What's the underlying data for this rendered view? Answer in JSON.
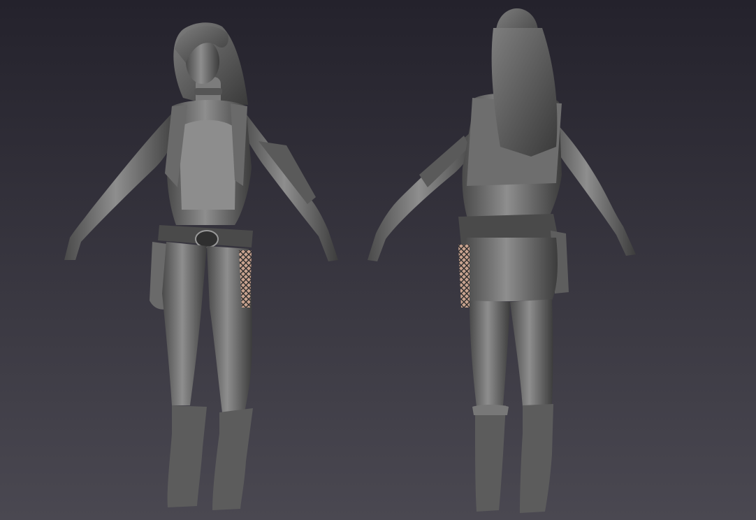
{
  "scene": {
    "description_key": "character-turnaround",
    "views": [
      "front",
      "back"
    ],
    "colors": {
      "bg_top": "#24222c",
      "bg_bottom": "#48464f",
      "clay_light": "#8a8a8a",
      "clay_mid": "#6a6a6a",
      "clay_dark": "#3e3e3e",
      "clay_shadow": "#2c2c2c",
      "skin_mesh": "#c9a38f"
    }
  }
}
